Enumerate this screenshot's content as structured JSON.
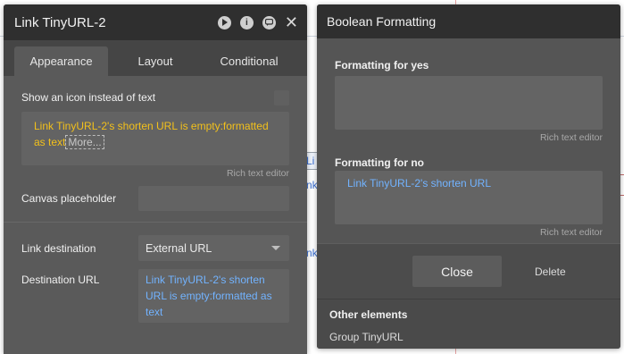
{
  "element_editor": {
    "title": "Link TinyURL-2",
    "tabs": [
      "Appearance",
      "Layout",
      "Conditional"
    ],
    "show_icon_label": "Show an icon instead of text",
    "text_value": "Link TinyURL-2's shorten URL is empty:formatted as text",
    "more_label": "More...",
    "rich_text_hint": "Rich text editor",
    "canvas_placeholder_label": "Canvas placeholder",
    "link_destination_label": "Link destination",
    "link_destination_value": "External URL",
    "destination_url_label": "Destination URL",
    "destination_url_value": "Link TinyURL-2's shorten URL is empty:formatted as text"
  },
  "boolean_formatting": {
    "title": "Boolean Formatting",
    "yes_label": "Formatting for yes",
    "yes_hint": "Rich text editor",
    "no_label": "Formatting for no",
    "no_value": "Link TinyURL-2's shorten URL",
    "no_hint": "Rich text editor",
    "close_label": "Close",
    "delete_label": "Delete",
    "other_elements_title": "Other elements",
    "other_elements_item": "Group TinyURL"
  },
  "background_canvas": {
    "fragment_1": "Li",
    "fragment_2": "nk",
    "fragment_3": "nk"
  },
  "colors": {
    "dynamic_expression": "#f2c01b",
    "dynamic_link": "#72b3ff",
    "panel_bg": "#505050",
    "header_bg": "#2f2f2f"
  },
  "icons": [
    "play-icon",
    "info-icon",
    "comment-icon",
    "close-icon",
    "dropdown-caret-icon"
  ]
}
